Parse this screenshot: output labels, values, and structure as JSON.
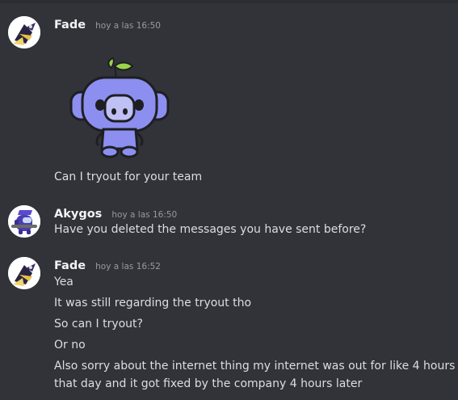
{
  "messages": {
    "m1": {
      "username": "Fade",
      "timestamp": "hoy a las 16:50",
      "avatar_icon": "fade-avatar-icon",
      "sticker_icon": "wumpus-sticker-icon",
      "text": "Can I tryout for your team"
    },
    "m2": {
      "username": "Akygos",
      "timestamp": "hoy a las 16:50",
      "avatar_icon": "akygos-avatar-icon",
      "text": "Have you deleted the messages you have sent before?"
    },
    "m3": {
      "username": "Fade",
      "timestamp": "hoy a las 16:52",
      "avatar_icon": "fade-avatar-icon",
      "lines": [
        "Yea",
        "It was still regarding the tryout tho",
        "So can I tryout?",
        "Or no",
        "Also sorry about the internet thing my internet was out for like 4 hours",
        "that day and it got fixed by the company 4 hours later"
      ]
    }
  },
  "colors": {
    "background": "#313338",
    "username": "#f2f3f5",
    "timestamp": "#949ba4",
    "text": "#dbdee1",
    "wumpus": "#8c8ff0"
  }
}
